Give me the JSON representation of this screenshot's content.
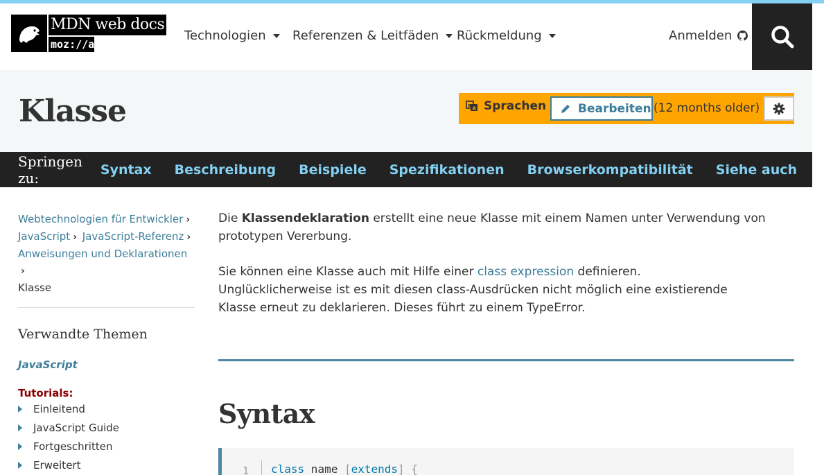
{
  "header": {
    "logo_title": "MDN web docs",
    "logo_moz": "moz://a",
    "nav": [
      {
        "label": "Technologien"
      },
      {
        "label": "Referenzen & Leitfäden"
      },
      {
        "label": "Rückmeldung"
      }
    ],
    "signin_label": "Anmelden",
    "search_icon": "search-icon"
  },
  "title_band": {
    "title": "Klasse",
    "languages_label": "Sprachen",
    "edit_label": "Bearbeiten",
    "older_note": "(12 months older)"
  },
  "jump": {
    "label": "Springen zu:",
    "links": [
      "Syntax",
      "Beschreibung",
      "Beispiele",
      "Spezifikationen",
      "Browserkompatibilität",
      "Siehe auch"
    ]
  },
  "sidebar": {
    "breadcrumbs": [
      "Webtechnologien für Entwickler",
      "JavaScript",
      "JavaScript-Referenz",
      "Anweisungen und Deklarationen",
      "Klasse"
    ],
    "related_title": "Verwandte Themen",
    "js_link": "JavaScript",
    "tutorials_title": "Tutorials:",
    "tutorials": [
      "Einleitend",
      "JavaScript Guide",
      "Fortgeschritten",
      "Erweitert"
    ]
  },
  "main": {
    "p1_before": "Die ",
    "p1_bold": "Klassendeklaration",
    "p1_after": " erstellt eine neue Klasse mit einem Namen unter Verwendung von prototypen Vererbung.",
    "p2_before": "Sie können eine Klasse auch mit Hilfe einer ",
    "p2_link": "class expression",
    "p2_after": " definieren.",
    "p2_line2": "Unglücklicherweise ist es mit diesen class-Ausdrücken nicht möglich eine existierende",
    "p2_line3": "Klasse erneut zu deklarieren. Dieses führt zu einem TypeError.",
    "syntax_heading": "Syntax",
    "code_line_no": "1",
    "code_kw1": "class",
    "code_name": " name ",
    "code_open": "[",
    "code_kw2": "extends",
    "code_close": "]",
    "code_brace": " {"
  },
  "colors": {
    "accent": "#3d7e9a",
    "jump_link": "#83d0f2",
    "toolbar": "#ffa500",
    "top_stripe": "#83d0f2",
    "tutorials": "#8b0000"
  }
}
